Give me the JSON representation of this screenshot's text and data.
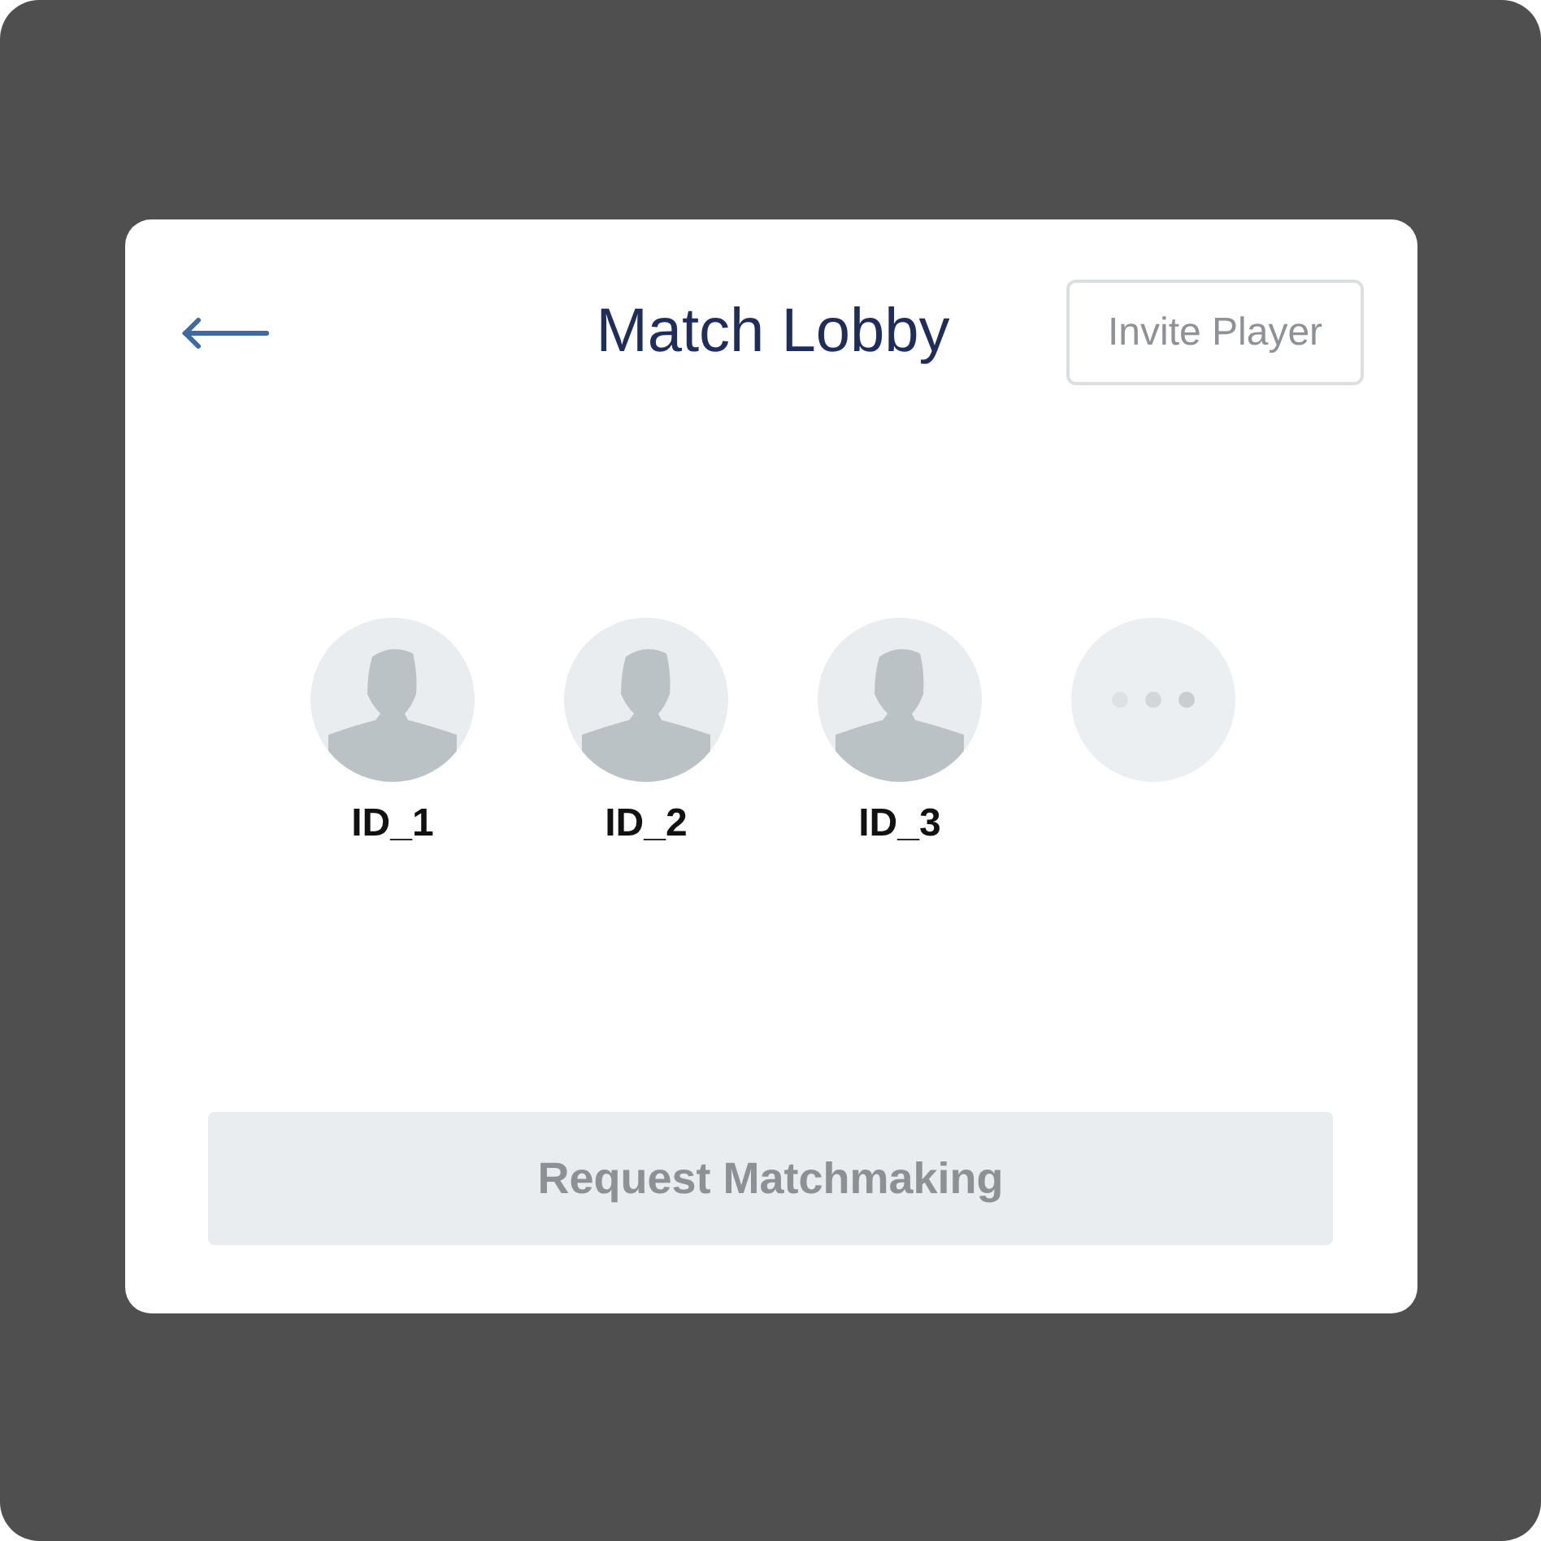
{
  "header": {
    "title": "Match Lobby",
    "invite_button": "Invite Player"
  },
  "players": [
    {
      "kind": "player",
      "name": "ID_1"
    },
    {
      "kind": "player",
      "name": "ID_2"
    },
    {
      "kind": "player",
      "name": "ID_3"
    },
    {
      "kind": "more"
    }
  ],
  "matchmaking_button": {
    "label": "Request Matchmaking",
    "disabled": true
  }
}
